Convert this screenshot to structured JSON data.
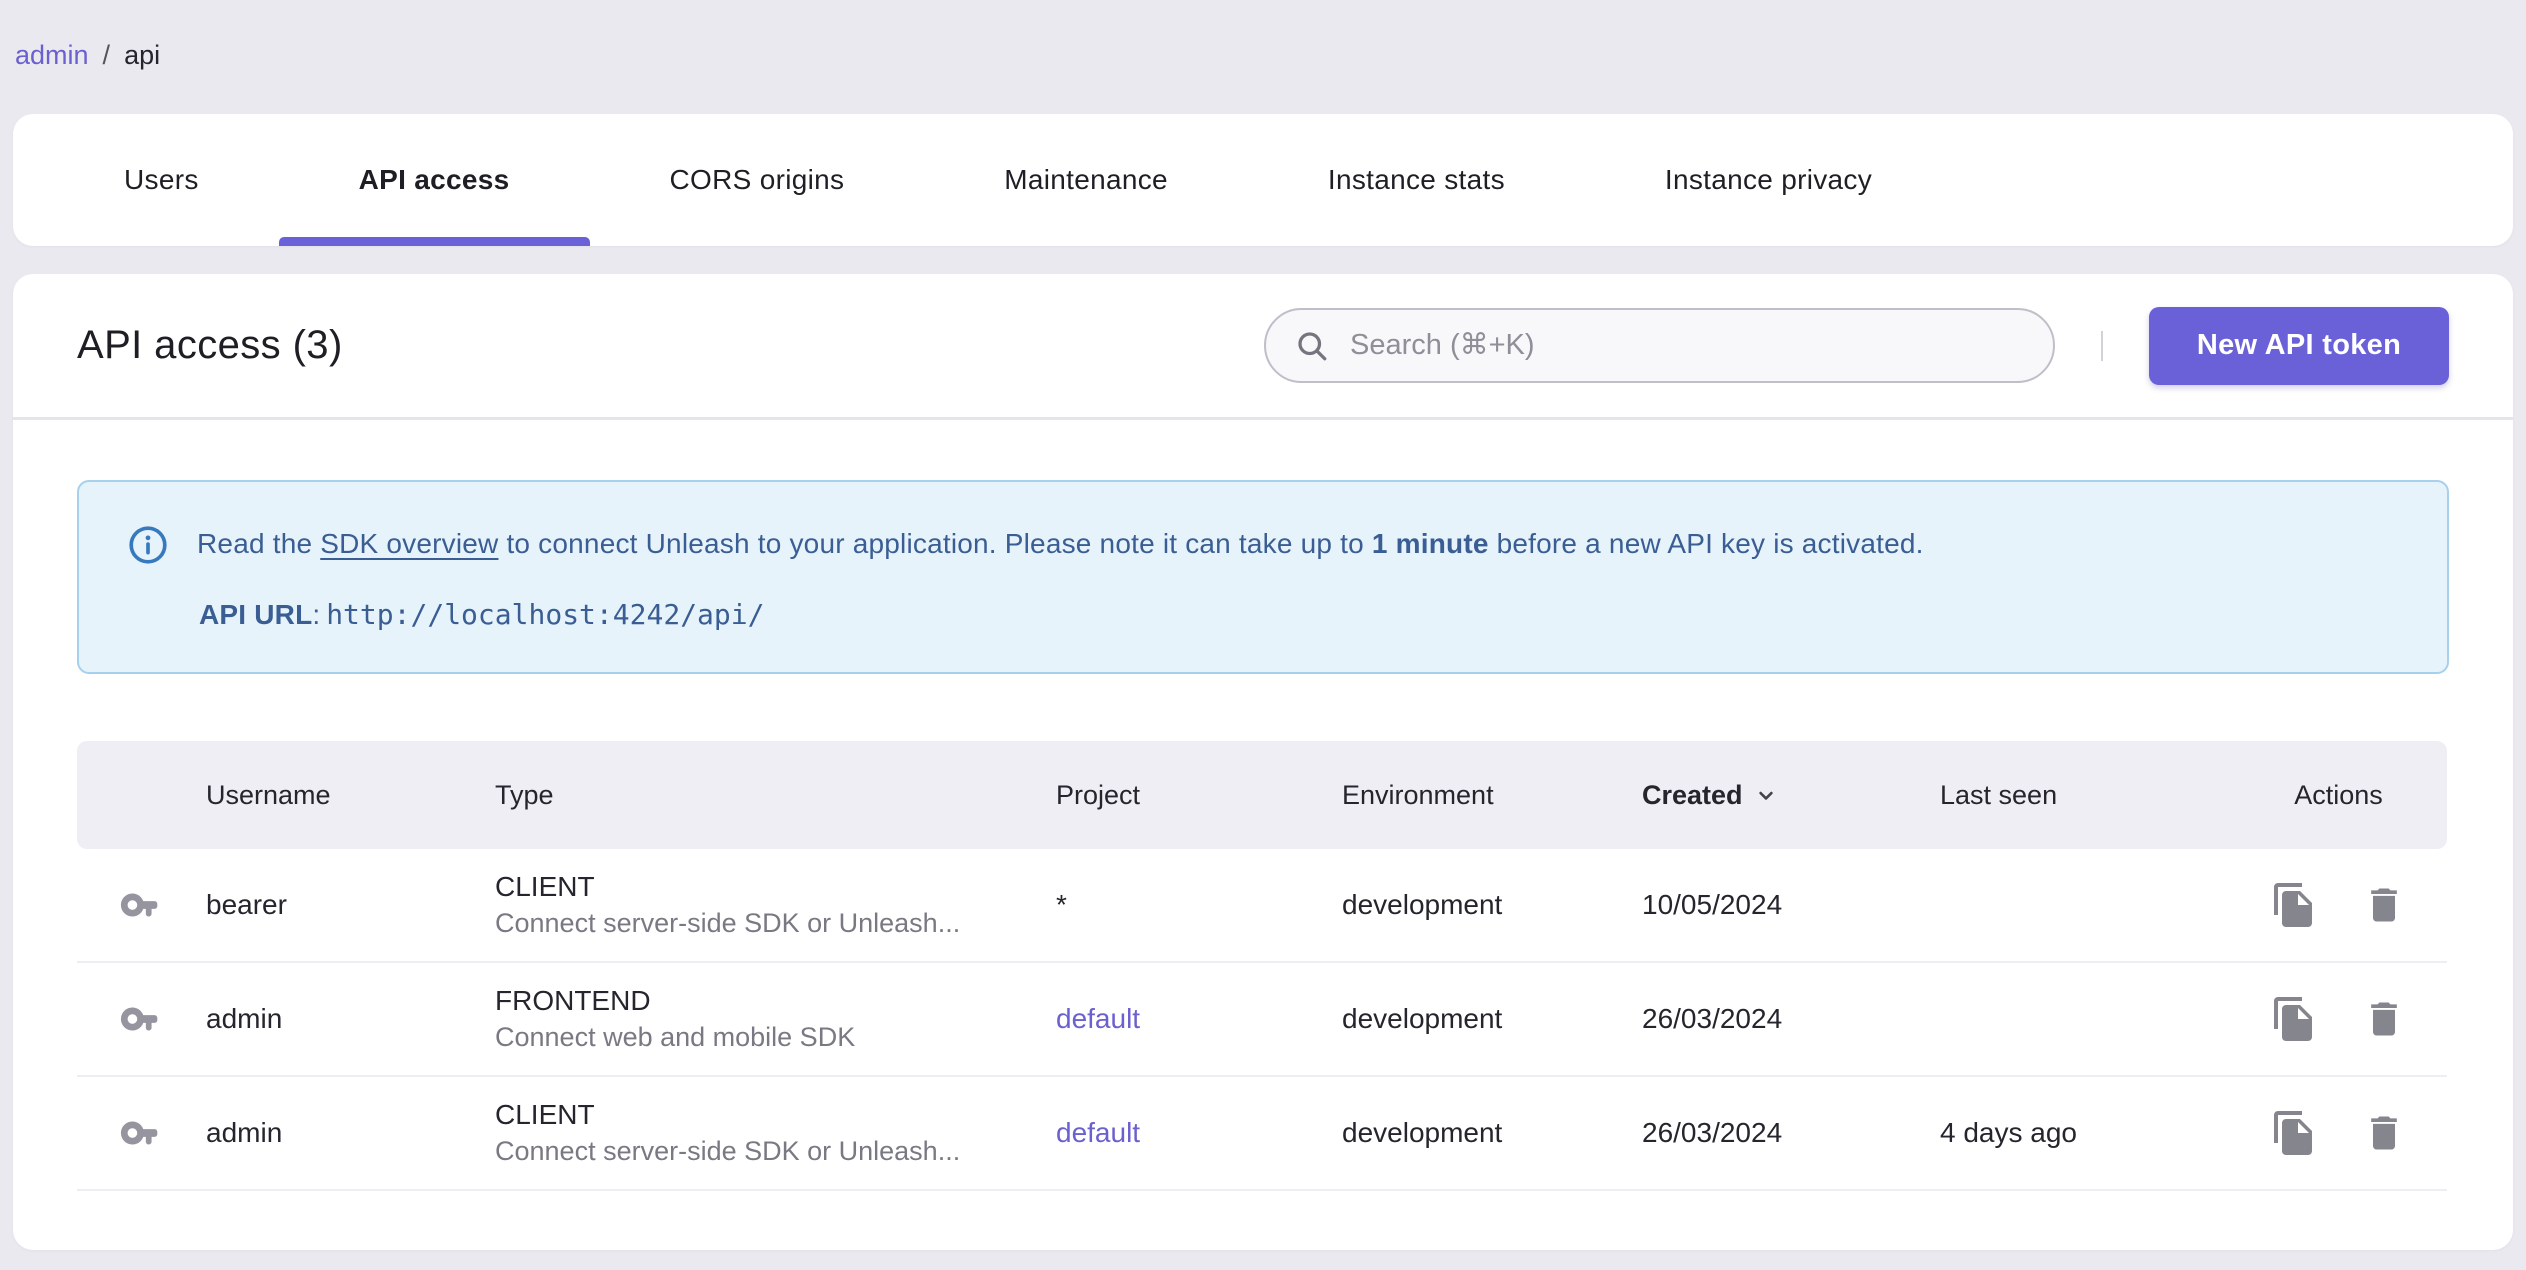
{
  "breadcrumb": {
    "separator": "/",
    "items": [
      {
        "label": "admin",
        "current": false
      },
      {
        "label": "api",
        "current": true
      }
    ]
  },
  "tabs": {
    "items": [
      {
        "label": "Users",
        "active": false
      },
      {
        "label": "API access",
        "active": true
      },
      {
        "label": "CORS origins",
        "active": false
      },
      {
        "label": "Maintenance",
        "active": false
      },
      {
        "label": "Instance stats",
        "active": false
      },
      {
        "label": "Instance privacy",
        "active": false
      }
    ]
  },
  "header": {
    "title": "API access (3)",
    "search_placeholder": "Search (⌘+K)",
    "new_token_button": "New API token"
  },
  "banner": {
    "text_prefix": "Read the ",
    "link": "SDK overview",
    "text_middle": " to connect Unleash to your application. Please note it can take up to ",
    "bold": "1 minute",
    "text_suffix": " before a new API key is activated.",
    "api_url_label": "API URL",
    "api_url_separator": ": ",
    "api_url": "http://localhost:4242/api/"
  },
  "table": {
    "headers": {
      "username": "Username",
      "type": "Type",
      "project": "Project",
      "environment": "Environment",
      "created": "Created",
      "last_seen": "Last seen",
      "actions": "Actions"
    },
    "sorted_by": "Created",
    "rows": [
      {
        "username": "bearer",
        "type": "CLIENT",
        "type_description": "Connect server-side SDK or Unleash...",
        "project": "*",
        "project_is_link": false,
        "environment": "development",
        "created": "10/05/2024",
        "last_seen": ""
      },
      {
        "username": "admin",
        "type": "FRONTEND",
        "type_description": "Connect web and mobile SDK",
        "project": "default",
        "project_is_link": true,
        "environment": "development",
        "created": "26/03/2024",
        "last_seen": ""
      },
      {
        "username": "admin",
        "type": "CLIENT",
        "type_description": "Connect server-side SDK or Unleash...",
        "project": "default",
        "project_is_link": true,
        "environment": "development",
        "created": "26/03/2024",
        "last_seen": "4 days ago"
      }
    ]
  },
  "colors": {
    "primary": "#6a61d9",
    "page_background": "#eae9ef",
    "banner_background": "#e7f3fb",
    "banner_text": "#3a5e93",
    "table_header_background": "#efeef4",
    "link_purple": "#6b60cf",
    "icon_gray": "#85858d"
  }
}
